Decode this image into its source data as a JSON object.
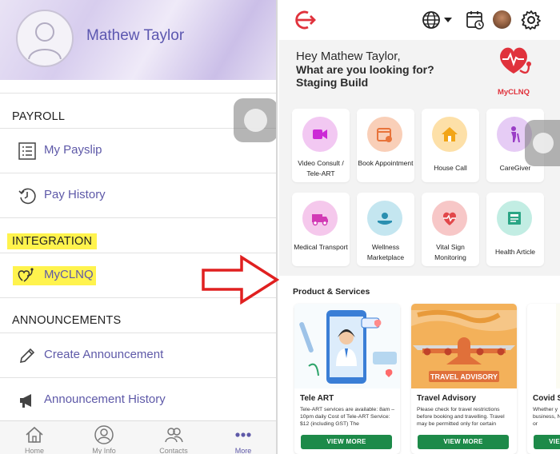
{
  "left": {
    "profile": {
      "name": "Mathew Taylor"
    },
    "sections": {
      "payroll": "PAYROLL",
      "integration": "INTEGRATION",
      "announcements": "ANNOUNCEMENTS"
    },
    "items": {
      "payslip": "My Payslip",
      "pay_history": "Pay History",
      "myclnq": "MyCLNQ",
      "create_announcement": "Create Announcement",
      "announcement_history": "Announcement History"
    },
    "tabbar": [
      {
        "label": "Home",
        "icon": "home-icon"
      },
      {
        "label": "My Info",
        "icon": "person-icon"
      },
      {
        "label": "Contacts",
        "icon": "contacts-icon"
      },
      {
        "label": "More",
        "icon": "more-icon"
      }
    ]
  },
  "right": {
    "greeting": {
      "line1": "Hey Mathew Taylor,",
      "line2": "What are you looking for?",
      "line3": "Staging Build"
    },
    "brand": {
      "label": "MyCLNQ"
    },
    "services": [
      {
        "label": "Video Consult / Tele-ART",
        "icon": "video-camera-icon",
        "color": "#f2c8f2",
        "fg": "#cc2ad6"
      },
      {
        "label": "Book Appointment",
        "icon": "calendar-icon",
        "color": "#f9cfb8",
        "fg": "#e8743b"
      },
      {
        "label": "House Call",
        "icon": "house-icon",
        "color": "#fde0a8",
        "fg": "#f2a516"
      },
      {
        "label": "CareGiver",
        "icon": "caregiver-icon",
        "color": "#e6ccf5",
        "fg": "#9a3ec6"
      },
      {
        "label": "Medical Transport",
        "icon": "ambulance-icon",
        "color": "#f5c8ec",
        "fg": "#d23ab5"
      },
      {
        "label": "Wellness Marketplace",
        "icon": "wellness-icon",
        "color": "#c4e6f0",
        "fg": "#2a8fb0"
      },
      {
        "label": "Vital Sign Monitoring",
        "icon": "heart-monitor-icon",
        "color": "#f7c7c7",
        "fg": "#e2474a"
      },
      {
        "label": "Health Article",
        "icon": "article-icon",
        "color": "#c2ede3",
        "fg": "#2aa585"
      }
    ],
    "products_title": "Product & Services",
    "cards": [
      {
        "title": "Tele ART",
        "desc": "Tele-ART services are available: 8am – 10pm daily Cost of Tele-ART Service: $12 (including GST) The",
        "button": "VIEW MORE"
      },
      {
        "title": "Travel Advisory",
        "banner": "TRAVEL ADVISORY",
        "desc": "Please check for travel restrictions before booking and travelling. Travel may be permitted only for certain",
        "button": "VIEW MORE"
      },
      {
        "title": "Covid S",
        "desc": "Whether y business, Notice or",
        "button": "VIEW"
      }
    ]
  },
  "colors": {
    "accent_purple": "#5e59a8",
    "brand_red": "#e0323c",
    "button_green": "#1d8a49",
    "highlight_yellow": "#fff34d",
    "arrow_red": "#e02020"
  }
}
